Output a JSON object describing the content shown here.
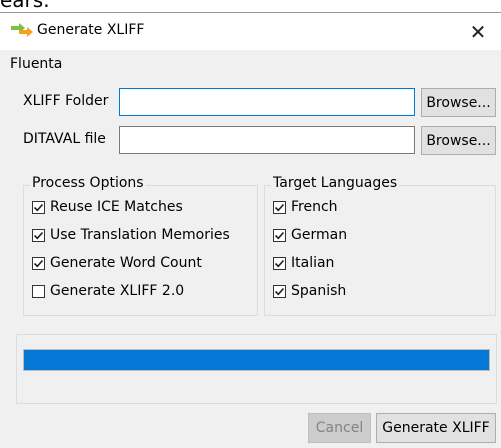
{
  "cropped_text": "ears.",
  "window": {
    "title": "Generate XLIFF",
    "close_symbol": "✕"
  },
  "brand": "Fluenta",
  "form": {
    "xliff_folder": {
      "label": "XLIFF Folder",
      "value": "",
      "browse": "Browse..."
    },
    "ditaval_file": {
      "label": "DITAVAL file",
      "value": "",
      "browse": "Browse..."
    }
  },
  "process_options": {
    "title": "Process Options",
    "items": [
      {
        "label": "Reuse ICE Matches",
        "checked": true
      },
      {
        "label": "Use Translation Memories",
        "checked": true
      },
      {
        "label": "Generate Word Count",
        "checked": true
      },
      {
        "label": "Generate XLIFF 2.0",
        "checked": false
      }
    ]
  },
  "target_languages": {
    "title": "Target Languages",
    "items": [
      {
        "label": "French",
        "checked": true
      },
      {
        "label": "German",
        "checked": true
      },
      {
        "label": "Italian",
        "checked": true
      },
      {
        "label": "Spanish",
        "checked": true
      }
    ]
  },
  "progress": {
    "fraction": 1.0
  },
  "buttons": {
    "cancel": "Cancel",
    "generate": "Generate XLIFF"
  },
  "colors": {
    "accent": "#0078d7",
    "progress": "#0678d5"
  }
}
